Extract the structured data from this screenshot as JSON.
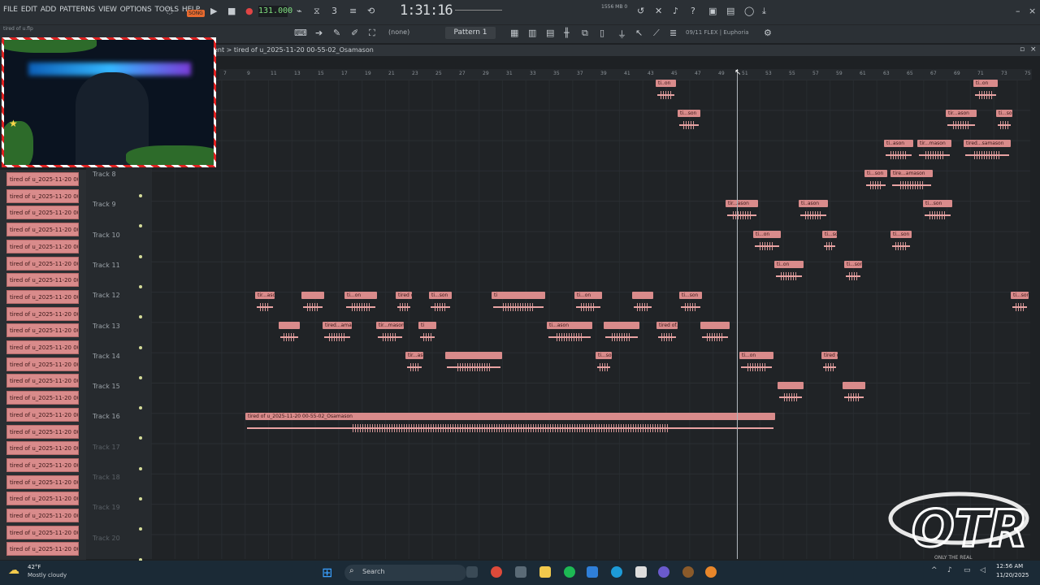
{
  "menu": {
    "items": [
      "FILE",
      "EDIT",
      "ADD",
      "PATTERNS",
      "VIEW",
      "OPTIONS",
      "TOOLS",
      "HELP"
    ]
  },
  "transport": {
    "song_label": "SONG",
    "tempo": "131.000",
    "time": "1:31:16",
    "mem": "1556 MB\n0"
  },
  "toolbar2": {
    "snap": "(none)",
    "pattern": "Pattern 1",
    "plugin": "09/11  FLEX | Euphoria"
  },
  "playlist": {
    "breadcrumb": "ent  >  tired of u_2025-11-20 00-55-02_Osamason"
  },
  "ruler": {
    "ticks": [
      "7",
      "9",
      "11",
      "13",
      "15",
      "17",
      "19",
      "21",
      "23",
      "25",
      "27",
      "29",
      "31",
      "33",
      "35",
      "37",
      "39",
      "41",
      "43",
      "45",
      "47",
      "49",
      "51",
      "53",
      "55",
      "57",
      "59",
      "61",
      "63",
      "65",
      "67",
      "69",
      "71",
      "73",
      "75"
    ]
  },
  "webcam": {
    "caption": "tired of u.flp"
  },
  "cliplist": {
    "label": "tired of u_2025-11-20 00..."
  },
  "tracks": [
    {
      "name": "Track 8",
      "dim": false
    },
    {
      "name": "Track 9",
      "dim": false
    },
    {
      "name": "Track 10",
      "dim": false
    },
    {
      "name": "Track 11",
      "dim": false
    },
    {
      "name": "Track 12",
      "dim": false
    },
    {
      "name": "Track 13",
      "dim": false
    },
    {
      "name": "Track 14",
      "dim": false
    },
    {
      "name": "Track 15",
      "dim": false
    },
    {
      "name": "Track 16",
      "dim": false
    },
    {
      "name": "Track 17",
      "dim": true
    },
    {
      "name": "Track 18",
      "dim": true
    },
    {
      "name": "Track 19",
      "dim": true
    },
    {
      "name": "Track 20",
      "dim": true
    }
  ],
  "clips": {
    "c1": "ti..on",
    "c2": "ti..on",
    "c3": "ti...son",
    "c4": "tir...ason",
    "c5": "ti...son",
    "c6": "ti..ason",
    "c7": "tir...mason",
    "c8": "tired...samason",
    "c9": "ti...son",
    "c10": "tire...amason",
    "c11": "tir...ason",
    "c12": "ti..ason",
    "c13": "ti...son",
    "c14": "ti...on",
    "c15": "ti...son",
    "c16": "ti...son",
    "c17": "ti..on",
    "c18": "ti...son",
    "c19": "tir...ason",
    "c20": "",
    "c21": "ti...on",
    "c22": "tired o...samason",
    "c23": "ti...son",
    "c24": "ti",
    "c25": "ti...on",
    "c26": "",
    "c27": "ti...son",
    "c28": "ti...son",
    "c29": "",
    "c30": "tired...amason",
    "c31": "tir...mason",
    "c32": "ti",
    "c33": "ti...ason",
    "c34": "",
    "c35": "tired of...Osamason",
    "c36": "",
    "c37": "tir...ason",
    "c38": "",
    "c39": "ti...son",
    "c40": "ti...on",
    "c41": "tired of u_2025-11-20 00-55-02_Osamason"
  },
  "taskbar": {
    "temp": "42°F",
    "weather": "Mostly cloudy",
    "search": "Search",
    "time": "12:56 AM",
    "date": "11/20/2025"
  },
  "logo": {
    "text": "OTR",
    "sub": "ONLY THE REAL"
  }
}
